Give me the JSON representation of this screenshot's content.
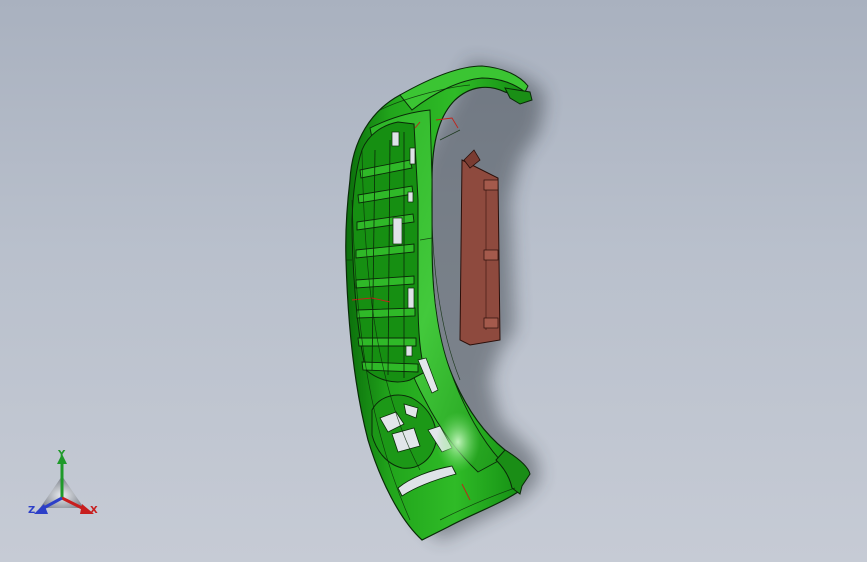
{
  "triad": {
    "x_label": "X",
    "y_label": "Y",
    "z_label": "Z"
  },
  "colors": {
    "background_top": "#a9b1bf",
    "background_bottom": "#c6cbd5",
    "part_green": "#1fa61a",
    "part_green_dark": "#0d6f0c",
    "part_green_light": "#5fd35a",
    "part_edge": "#0a2a08",
    "mounting_plate": "#8e4a3e",
    "axis_x": "#c81e1e",
    "axis_y": "#1f9a2a",
    "axis_z": "#2c3fc8"
  },
  "icons": {
    "model": "bumper-part-icon",
    "triad": "reference-triad-icon"
  }
}
